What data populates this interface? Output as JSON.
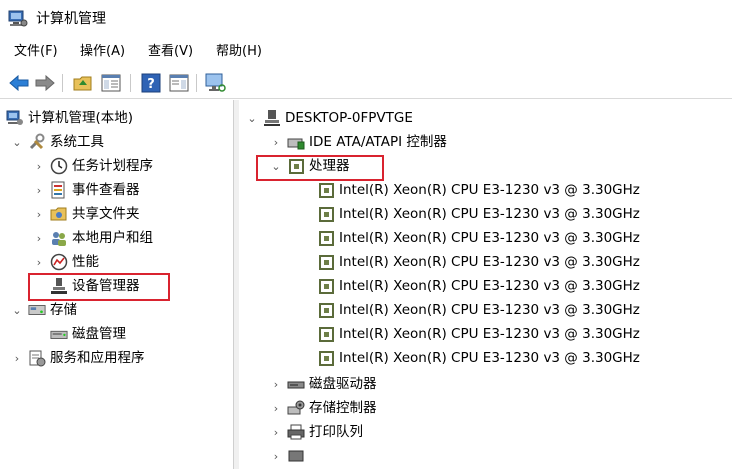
{
  "window": {
    "title": "计算机管理"
  },
  "menu": [
    {
      "label": "文件(F)"
    },
    {
      "label": "操作(A)"
    },
    {
      "label": "查看(V)"
    },
    {
      "label": "帮助(H)"
    }
  ],
  "left_tree": {
    "root": "计算机管理(本地)",
    "system_tools": "系统工具",
    "system_items": [
      {
        "label": "任务计划程序",
        "icon": "clock-icon"
      },
      {
        "label": "事件查看器",
        "icon": "event-viewer-icon"
      },
      {
        "label": "共享文件夹",
        "icon": "shared-folder-icon"
      },
      {
        "label": "本地用户和组",
        "icon": "users-icon"
      },
      {
        "label": "性能",
        "icon": "performance-icon"
      },
      {
        "label": "设备管理器",
        "icon": "device-manager-icon"
      }
    ],
    "storage": "存储",
    "storage_items": [
      {
        "label": "磁盘管理",
        "icon": "disk-icon"
      }
    ],
    "services": "服务和应用程序"
  },
  "right_tree": {
    "computer": "DESKTOP-0FPVTGE",
    "ide": "IDE ATA/ATAPI 控制器",
    "processors": "处理器",
    "cpus": [
      "Intel(R) Xeon(R) CPU E3-1230 v3 @ 3.30GHz",
      "Intel(R) Xeon(R) CPU E3-1230 v3 @ 3.30GHz",
      "Intel(R) Xeon(R) CPU E3-1230 v3 @ 3.30GHz",
      "Intel(R) Xeon(R) CPU E3-1230 v3 @ 3.30GHz",
      "Intel(R) Xeon(R) CPU E3-1230 v3 @ 3.30GHz",
      "Intel(R) Xeon(R) CPU E3-1230 v3 @ 3.30GHz",
      "Intel(R) Xeon(R) CPU E3-1230 v3 @ 3.30GHz",
      "Intel(R) Xeon(R) CPU E3-1230 v3 @ 3.30GHz"
    ],
    "disk_drives": "磁盘驱动器",
    "storage_controllers": "存储控制器",
    "print_queues": "打印队列"
  },
  "colors": {
    "highlight_box": "#d9232f",
    "selected_row": "#e5e5e5"
  }
}
